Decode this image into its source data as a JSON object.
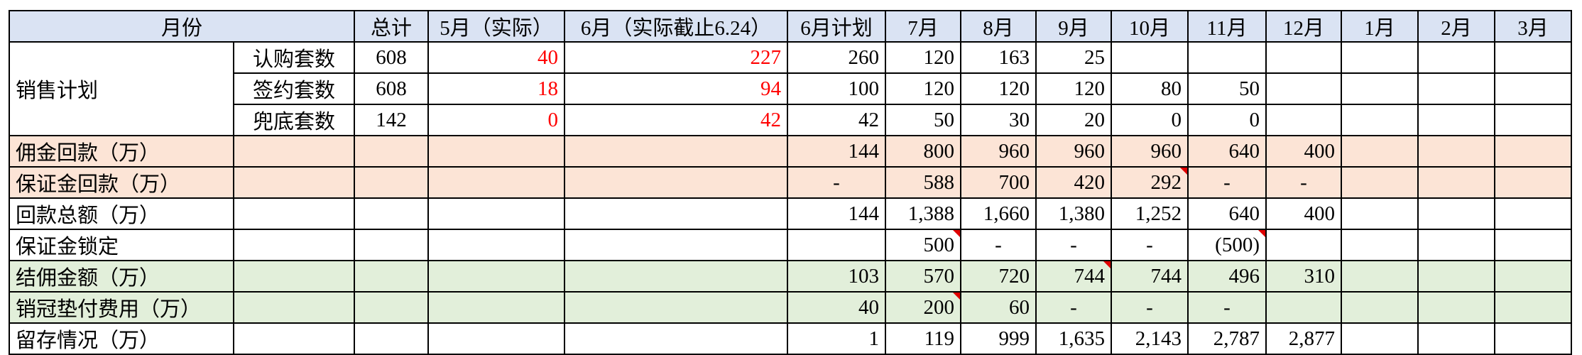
{
  "header": [
    "月份",
    "",
    "总计",
    "5月（实际）",
    "6月（实际截止6.24）",
    "6月计划",
    "7月",
    "8月",
    "9月",
    "10月",
    "11月",
    "12月",
    "1月",
    "2月",
    "3月"
  ],
  "sales_group_label": "销售计划",
  "sales_rows": [
    {
      "label": "认购套数",
      "total": "608",
      "may": "40",
      "june_actual": "227",
      "months": [
        "260",
        "120",
        "163",
        "25",
        "",
        "",
        "",
        "",
        "",
        ""
      ]
    },
    {
      "label": "签约套数",
      "total": "608",
      "may": "18",
      "june_actual": "94",
      "months": [
        "100",
        "120",
        "120",
        "120",
        "80",
        "50",
        "",
        "",
        "",
        ""
      ]
    },
    {
      "label": "兜底套数",
      "total": "142",
      "may": "0",
      "june_actual": "42",
      "months": [
        "42",
        "50",
        "30",
        "20",
        "0",
        "0",
        "",
        "",
        "",
        ""
      ]
    }
  ],
  "finance_rows": [
    {
      "label": "佣金回款（万）",
      "months": [
        "144",
        "800",
        "960",
        "960",
        "960",
        "640",
        "400",
        "",
        "",
        ""
      ]
    },
    {
      "label": "保证金回款（万）",
      "months": [
        "-",
        "588",
        "700",
        "420",
        "292",
        "-",
        "-",
        "",
        "",
        ""
      ]
    },
    {
      "label": "回款总额（万）",
      "months": [
        "144",
        "1,388",
        "1,660",
        "1,380",
        "1,252",
        "640",
        "400",
        "",
        "",
        ""
      ]
    },
    {
      "label": "保证金锁定",
      "months": [
        "",
        "500",
        "-",
        "-",
        "-",
        "(500)",
        "",
        "",
        "",
        ""
      ]
    },
    {
      "label": "结佣金额（万）",
      "months": [
        "103",
        "570",
        "720",
        "744",
        "744",
        "496",
        "310",
        "",
        "",
        ""
      ]
    },
    {
      "label": "销冠垫付费用（万）",
      "months": [
        "40",
        "200",
        "60",
        "-",
        "-",
        "-",
        "",
        "",
        "",
        ""
      ]
    },
    {
      "label": "留存情况（万）",
      "months": [
        "1",
        "119",
        "999",
        "1,635",
        "2,143",
        "2,787",
        "2,877",
        "",
        "",
        ""
      ]
    }
  ],
  "colors": {
    "header_fill": "#dae3f3",
    "pink_fill": "#fce4d6",
    "green_fill": "#e2efda",
    "actual_text": "#ff0000",
    "comment_marker": "#e00000"
  }
}
